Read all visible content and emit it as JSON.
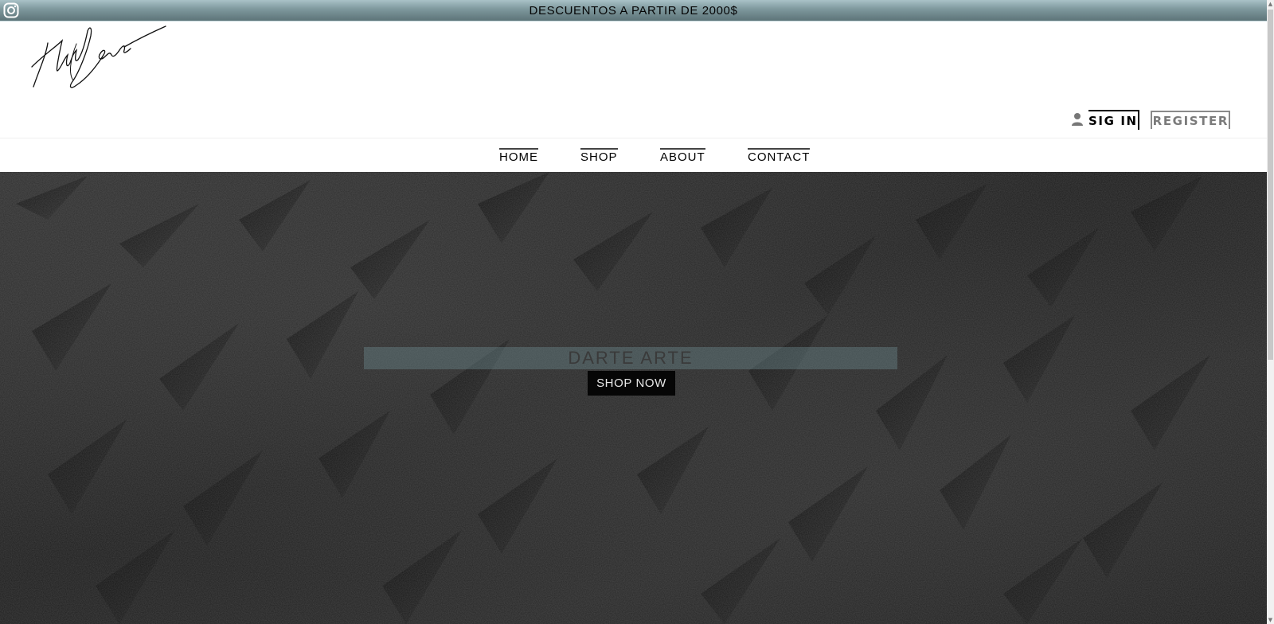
{
  "topbar": {
    "promo_text": "DESCUENTOS A PARTIR DE 2000$",
    "social_icon": "instagram-icon"
  },
  "header": {
    "logo_icon": "signature-logo",
    "user_icon": "user-icon",
    "sign_in_label": "SIG IN",
    "register_label": "REGISTER"
  },
  "nav": {
    "items": [
      {
        "label": "HOME"
      },
      {
        "label": "SHOP"
      },
      {
        "label": "ABOUT"
      },
      {
        "label": "CONTACT"
      }
    ]
  },
  "hero": {
    "title": "DARTE ARTE",
    "cta_label": "SHOP NOW"
  },
  "colors": {
    "topbar": "#7d979c",
    "hero_bg": "#222222",
    "title_band": "#6e8c91",
    "cta_bg": "#060606"
  }
}
